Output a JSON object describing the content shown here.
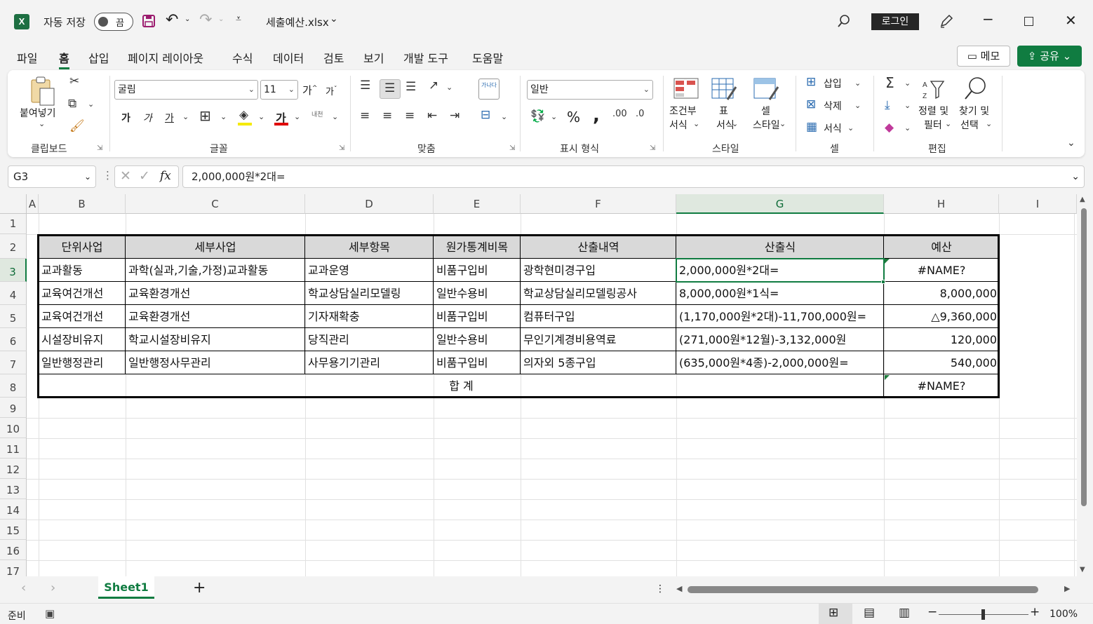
{
  "titlebar": {
    "autosave_label": "자동 저장",
    "autosave_state": "끔",
    "filename": "세출예산.xlsx",
    "login": "로그인"
  },
  "menu": {
    "tabs": [
      "파일",
      "홈",
      "삽입",
      "페이지 레이아웃",
      "수식",
      "데이터",
      "검토",
      "보기",
      "개발 도구",
      "도움말"
    ],
    "active": "홈",
    "memo": "메모",
    "share": "공유"
  },
  "ribbon": {
    "clipboard": {
      "paste": "붙여넣기",
      "label": "클립보드"
    },
    "font": {
      "name": "굴림",
      "size": "11",
      "grow": "가",
      "shrink": "가",
      "bold": "가",
      "italic": "가",
      "underline": "가",
      "font_color": "가",
      "phonetic": "내천",
      "label": "글꼴"
    },
    "alignment": {
      "wrap": "가나다",
      "label": "맞춤"
    },
    "number": {
      "format": "일반",
      "percent": "%",
      "comma": ",",
      "label": "표시 형식"
    },
    "styles": {
      "conditional": [
        "조건부",
        "서식"
      ],
      "table": [
        "표",
        "서식"
      ],
      "cell": [
        "셀",
        "스타일"
      ],
      "label": "스타일"
    },
    "cells": {
      "insert": "삽입",
      "delete": "삭제",
      "format": "서식",
      "label": "셀"
    },
    "editing": {
      "sort": [
        "정렬 및",
        "필터"
      ],
      "find": [
        "찾기 및",
        "선택"
      ],
      "label": "편집"
    }
  },
  "formula_bar": {
    "name_box": "G3",
    "fx": "fx",
    "formula": "2,000,000원*2대="
  },
  "grid": {
    "columns": [
      "A",
      "B",
      "C",
      "D",
      "E",
      "F",
      "G",
      "H",
      "I"
    ],
    "selected_column": "G",
    "rows": [
      "1",
      "2",
      "3",
      "4",
      "5",
      "6",
      "7",
      "8",
      "9",
      "10",
      "11",
      "12",
      "13",
      "14",
      "15",
      "16",
      "17"
    ],
    "selected_row": "3",
    "headers": [
      "단위사업",
      "세부사업",
      "세부항목",
      "원가통계비목",
      "산출내역",
      "산출식",
      "예산"
    ],
    "data_rows": [
      [
        "교과활동",
        "과학(실과,기술,가정)교과활동",
        "교과운영",
        "비품구입비",
        "광학현미경구입",
        "2,000,000원*2대=",
        "#NAME?"
      ],
      [
        "교육여건개선",
        "교육환경개선",
        "학교상담실리모델링",
        "일반수용비",
        "학교상담실리모델링공사",
        "8,000,000원*1식=",
        "8,000,000"
      ],
      [
        "교육여건개선",
        "교육환경개선",
        "기자재확충",
        "비품구입비",
        "컴퓨터구입",
        "(1,170,000원*2대)-11,700,000원=",
        "△9,360,000"
      ],
      [
        "시설장비유지",
        "학교시설장비유지",
        "당직관리",
        "일반수용비",
        "무인기계경비용역료",
        "(271,000원*12월)-3,132,000원",
        "120,000"
      ],
      [
        "일반행정관리",
        "일반행정사무관리",
        "사무용기기관리",
        "비품구입비",
        "의자외 5종구입",
        "(635,000원*4종)-2,000,000원=",
        "540,000"
      ]
    ],
    "total_label": "합 계",
    "total_value": "#NAME?"
  },
  "sheets": {
    "tabs": [
      "Sheet1"
    ],
    "add": "+"
  },
  "status": {
    "ready": "준비",
    "zoom": "100%"
  },
  "colors": {
    "accent": "#107c41",
    "header_fill": "#d9d9d9",
    "error_triangle": "#1e7b3c"
  }
}
